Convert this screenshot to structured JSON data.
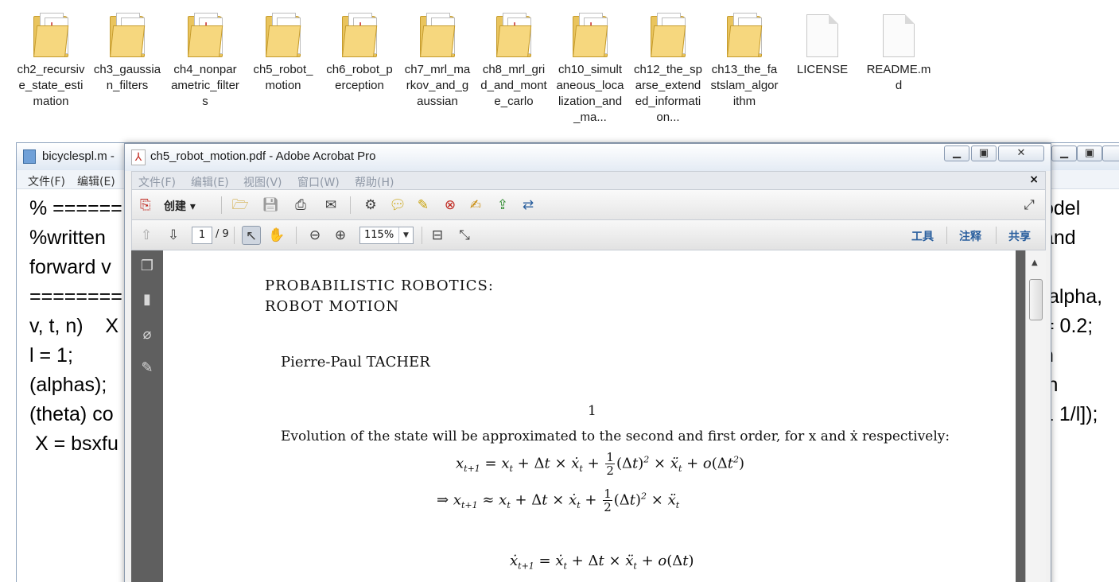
{
  "desktop": {
    "items": [
      {
        "label": "ch2_recursive_state_estimation",
        "kind": "folder-pdf"
      },
      {
        "label": "ch3_gaussian_filters",
        "kind": "folder"
      },
      {
        "label": "ch4_nonparametric_filters",
        "kind": "folder-pdf"
      },
      {
        "label": "ch5_robot_motion",
        "kind": "folder"
      },
      {
        "label": "ch6_robot_perception",
        "kind": "folder-pdf"
      },
      {
        "label": "ch7_mrl_markov_and_gaussian",
        "kind": "folder"
      },
      {
        "label": "ch8_mrl_grid_and_monte_carlo",
        "kind": "folder-pdf"
      },
      {
        "label": "ch10_simultaneous_localization_and_ma...",
        "kind": "folder-pdf"
      },
      {
        "label": "ch12_the_sparse_extended_information...",
        "kind": "folder"
      },
      {
        "label": "ch13_the_fastslam_algorithm",
        "kind": "folder"
      },
      {
        "label": "LICENSE",
        "kind": "file"
      },
      {
        "label": "README.md",
        "kind": "file"
      }
    ]
  },
  "editor": {
    "title": "bicyclespl.m -",
    "menu": [
      "文件(F)",
      "编辑(E)"
    ],
    "code_left": [
      "% ======",
      "%written",
      "forward v",
      "========",
      "v, t, n)    X",
      "l = 1;",
      "(alphas);",
      "(theta) co",
      " X = bsxfu"
    ],
    "code_right": [
      "odel",
      "and",
      "",
      " alpha,",
      "= 0.2;",
      "n",
      "in",
      "1 1/l]);",
      ""
    ]
  },
  "acrobat": {
    "title": "ch5_robot_motion.pdf - Adobe Acrobat Pro",
    "menu": [
      "文件(F)",
      "编辑(E)",
      "视图(V)",
      "窗口(W)",
      "帮助(H)"
    ],
    "create_label": "创建",
    "page_current": "1",
    "page_total": "/ 9",
    "zoom": "115%",
    "right_links": [
      "工具",
      "注释",
      "共享"
    ]
  },
  "pdf": {
    "title_line1": "PROBABILISTIC ROBOTICS:",
    "title_line2": "ROBOT MOTION",
    "author": "Pierre-Paul TACHER",
    "section": "1",
    "intro": "Evolution of the state will be approximated to the second and first order, for x and ẋ respectively:"
  },
  "colors": {
    "acrobat_red": "#c0281f",
    "link_blue": "#2a5f9e",
    "folder_yellow": "#e9c45d",
    "left_panel": "#5f5f5f"
  }
}
